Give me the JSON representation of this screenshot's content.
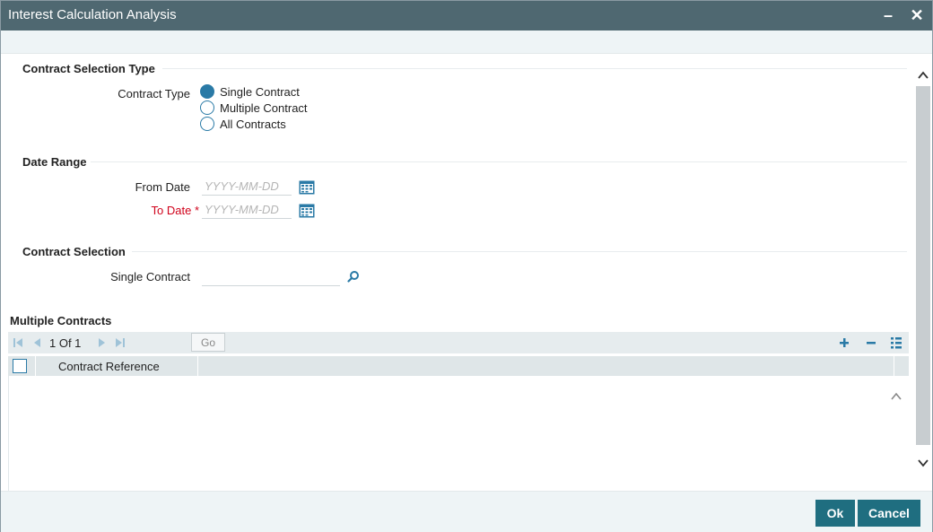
{
  "window": {
    "title": "Interest Calculation Analysis"
  },
  "sections": {
    "contract_selection_type": "Contract Selection Type",
    "date_range": "Date Range",
    "contract_selection": "Contract Selection",
    "multiple_contracts": "Multiple Contracts"
  },
  "contract_type": {
    "label": "Contract Type",
    "options": [
      {
        "label": "Single Contract",
        "checked": true
      },
      {
        "label": "Multiple Contract",
        "checked": false
      },
      {
        "label": "All Contracts",
        "checked": false
      }
    ]
  },
  "date_range": {
    "from_label": "From Date",
    "to_label": "To Date",
    "required_mark": "*",
    "from_placeholder": "YYYY-MM-DD",
    "to_placeholder": "YYYY-MM-DD"
  },
  "single_contract": {
    "label": "Single Contract",
    "value": ""
  },
  "grid": {
    "page_text": "1 Of 1",
    "go_label": "Go",
    "columns": [
      "Contract Reference"
    ],
    "rows": []
  },
  "footer": {
    "ok_label": "Ok",
    "cancel_label": "Cancel"
  },
  "colors": {
    "titlebar": "#4f6871",
    "accent": "#2a7aa6",
    "button": "#1f6e80",
    "required": "#d0021b"
  }
}
